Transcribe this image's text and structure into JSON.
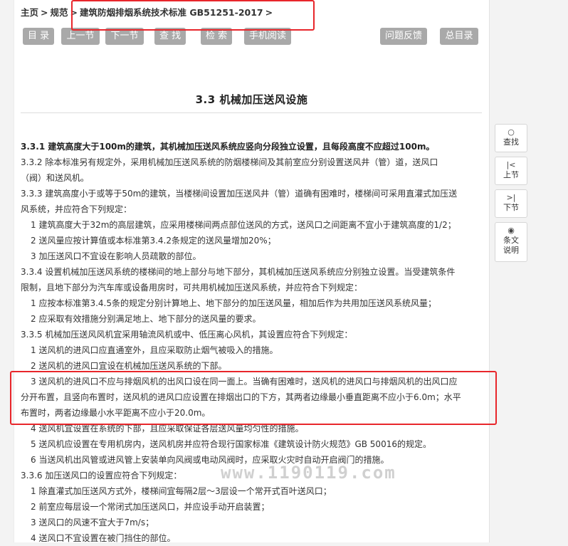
{
  "breadcrumb": {
    "home": "主页",
    "spec": "规范",
    "current": "建筑防烟排烟系统技术标准 GB51251-2017",
    "sep": ">"
  },
  "toolbar": {
    "catalog": "目 录",
    "prev": "上一节",
    "next": "下一节",
    "find": "查 找",
    "search": "检 索",
    "mobile": "手机阅读",
    "feedback": "问题反馈",
    "all_catalog": "总目录"
  },
  "section_title": "3.3 机械加压送风设施",
  "content": [
    "3.3.1 建筑高度大于100m的建筑，其机械加压送风系统应竖向分段独立设置，且每段高度不应超过100m。",
    "3.3.2 除本标准另有规定外，采用机械加压送风系统的防烟楼梯间及其前室应分别设置送风井（管）道，送风口",
    "（阀）和送风机。",
    "3.3.3 建筑高度小于或等于50m的建筑，当楼梯间设置加压送风井（管）道确有困难时，楼梯间可采用直灌式加压送",
    "风系统，并应符合下列规定：",
    "1 建筑高度大于32m的高层建筑，应采用楼梯间两点部位送风的方式，送风口之间距离不宜小于建筑高度的1/2；",
    "2 送风量应按计算值或本标准第3.4.2条规定的送风量增加20%；",
    "3 加压送风口不宜设在影响人员疏散的部位。",
    "3.3.4 设置机械加压送风系统的楼梯间的地上部分与地下部分，其机械加压送风系统应分别独立设置。当受建筑条件",
    "限制，且地下部分为汽车库或设备用房时，可共用机械加压送风系统，并应符合下列规定：",
    "1 应按本标准第3.4.5条的规定分别计算地上、地下部分的加压送风量，相加后作为共用加压送风系统风量；",
    "2 应采取有效措施分别满足地上、地下部分的送风量的要求。",
    "3.3.5 机械加压送风风机宜采用轴流风机或中、低压离心风机，其设置应符合下列规定：",
    "1 送风机的进风口应直通室外，且应采取防止烟气被吸入的措施。",
    "2 送风机的进风口宜设在机械加压送风系统的下部。",
    "3 送风机的进风口不应与排烟风机的出风口设在同一面上。当确有困难时，送风机的进风口与排烟风机的出风口应",
    "分开布置，且竖向布置时，送风机的进风口应设置在排烟出口的下方，其两者边缘最小垂直距离不应小于6.0m；水平",
    "布置时，两者边缘最小水平距离不应小于20.0m。",
    "4 送风机宜设置在系统的下部，且应采取保证各层送风量均匀性的措施。",
    "5 送风机应设置在专用机房内，送风机房并应符合现行国家标准《建筑设计防火规范》GB 50016的规定。",
    "6 当送风机出风管或进风管上安装单向风阀或电动风阀时，应采取火灾时自动开启阀门的措施。",
    "3.3.6 加压送风口的设置应符合下列规定：",
    "1 除直灌式加压送风方式外，楼梯间宜每隔2层～3层设一个常开式百叶送风口；",
    "2 前室应每层设一个常闭式加压送风口，并应设手动开启装置；",
    "3 送风口的风速不宜大于7m/s；",
    "4 送风口不宜设置在被门挡住的部位。"
  ],
  "watermark": "www.1190119.com",
  "right_nav": {
    "find": "查找",
    "prev": "上节",
    "next": "下节",
    "explain_1": "条文",
    "explain_2": "说明"
  }
}
